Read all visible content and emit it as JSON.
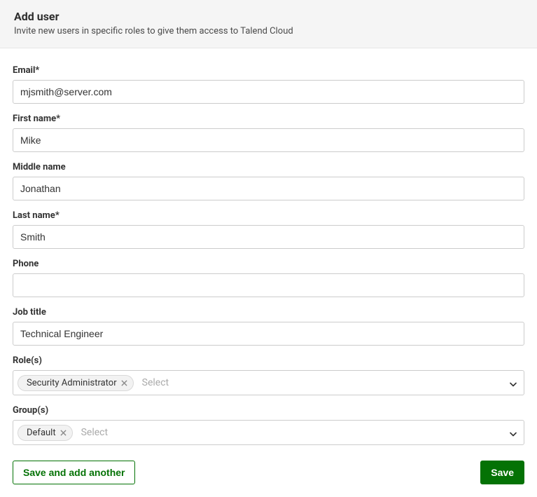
{
  "header": {
    "title": "Add user",
    "subtitle": "Invite new users in specific roles to give them access to Talend Cloud"
  },
  "form": {
    "email": {
      "label": "Email*",
      "value": "mjsmith@server.com"
    },
    "firstName": {
      "label": "First name*",
      "value": "Mike"
    },
    "middleName": {
      "label": "Middle name",
      "value": "Jonathan"
    },
    "lastName": {
      "label": "Last name*",
      "value": "Smith"
    },
    "phone": {
      "label": "Phone",
      "value": ""
    },
    "jobTitle": {
      "label": "Job title",
      "value": "Technical Engineer"
    },
    "roles": {
      "label": "Role(s)",
      "selected": "Security Administrator",
      "placeholder": "Select"
    },
    "groups": {
      "label": "Group(s)",
      "selected": "Default",
      "placeholder": "Select"
    }
  },
  "footer": {
    "saveAddAnother": "Save and add another",
    "save": "Save"
  }
}
